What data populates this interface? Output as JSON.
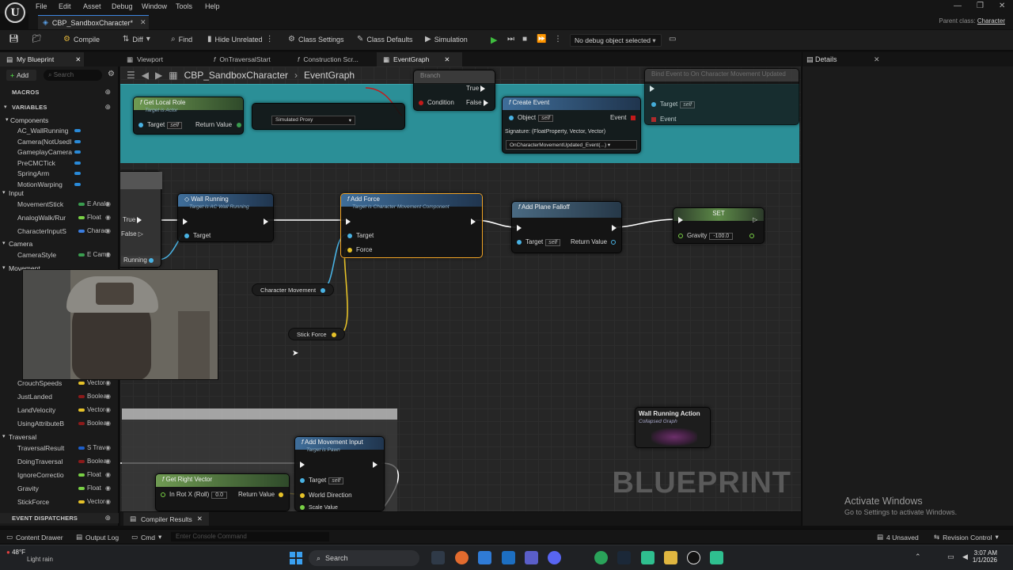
{
  "menu": {
    "items": [
      "File",
      "Edit",
      "Asset",
      "Debug",
      "Window",
      "Tools",
      "Help"
    ]
  },
  "asset_tab": {
    "title": "CBP_SandboxCharacter*"
  },
  "parent_class": {
    "label": "Parent class:",
    "value": "Character"
  },
  "toolbar": {
    "compile": "Compile",
    "diff": "Diff",
    "find": "Find",
    "hide_unrelated": "Hide Unrelated",
    "class_settings": "Class Settings",
    "class_defaults": "Class Defaults",
    "simulation": "Simulation",
    "debug_object": "No debug object selected"
  },
  "editor_tabs": {
    "my_blueprint": "My Blueprint",
    "viewport": "Viewport",
    "on_traversal_start": "OnTraversalStart",
    "construction_script": "Construction Scr...",
    "event_graph": "EventGraph",
    "details": "Details"
  },
  "left_panel": {
    "add": "Add",
    "search_placeholder": "Search",
    "macros": "MACROS",
    "variables": "VARIABLES",
    "categories": {
      "components": "Components",
      "input": "Input",
      "camera": "Camera",
      "movement": "Movement",
      "traversal": "Traversal"
    },
    "components": [
      {
        "name": "AC_WallRunning"
      },
      {
        "name": "Camera(NotUsedI"
      },
      {
        "name": "GameplayCamera"
      },
      {
        "name": "PreCMCTick"
      },
      {
        "name": "SpringArm"
      },
      {
        "name": "MotionWarping"
      }
    ],
    "input_vars": [
      {
        "name": "MovementStick",
        "type": "E Analc",
        "color": "#3a9d4f"
      },
      {
        "name": "AnalogWalk/Rur",
        "type": "Float",
        "color": "#79d045"
      },
      {
        "name": "CharacterInputS",
        "type": "Charac",
        "color": "#3a7de0"
      }
    ],
    "camera_vars": [
      {
        "name": "CameraStyle",
        "type": "E Came",
        "color": "#3a9d4f"
      }
    ],
    "movement_vars": [
      {
        "name": "CrouchSpeeds",
        "type": "Vector",
        "color": "#e6c229"
      },
      {
        "name": "JustLanded",
        "type": "Boolea",
        "color": "#8b1a1a"
      },
      {
        "name": "LandVelocity",
        "type": "Vector",
        "color": "#e6c229"
      },
      {
        "name": "UsingAttributeB",
        "type": "Boolea",
        "color": "#8b1a1a"
      }
    ],
    "traversal_vars": [
      {
        "name": "TraversalResult",
        "type": "S Trav",
        "color": "#1d5ec9"
      },
      {
        "name": "DoingTraversal",
        "type": "Boolea",
        "color": "#8b1a1a"
      },
      {
        "name": "IgnoreCorrectio",
        "type": "Float",
        "color": "#79d045"
      },
      {
        "name": "Gravity",
        "type": "Float",
        "color": "#79d045"
      },
      {
        "name": "StickForce",
        "type": "Vector",
        "color": "#e6c229"
      }
    ],
    "event_dispatchers": "EVENT DISPATCHERS"
  },
  "graph": {
    "breadcrumb": {
      "asset": "CBP_SandboxCharacter",
      "graph": "EventGraph"
    },
    "nodes": {
      "get_local_role": {
        "title": "Get Local Role",
        "sub": "Target is Actor",
        "target": "Target",
        "self": "self",
        "ret": "Return Value"
      },
      "simulated_proxy": "Simulated Proxy",
      "branch": {
        "title": "Branch",
        "condition": "Condition",
        "true": "True",
        "false": "False"
      },
      "create_event": {
        "title": "Create Event",
        "object": "Object",
        "self": "self",
        "event": "Event",
        "signature": "Signature: (FloatProperty, Vector, Vector)",
        "func": "OnCharacterMovementUpdated_Event(...)"
      },
      "bind_event": {
        "title": "Bind Event to On Character Movement Updated",
        "target": "Target",
        "self": "self",
        "event": "Event"
      },
      "wall_running": {
        "title": "Wall Running",
        "sub": "Target is AC Wall Running",
        "target": "Target"
      },
      "partial_branch": {
        "true": "True",
        "false": "False",
        "running": "Running"
      },
      "add_force": {
        "title": "Add Force",
        "sub": "Target is Character Movement Component",
        "target": "Target",
        "force": "Force"
      },
      "add_plane_falloff": {
        "title": "Add Plane Falloff",
        "target": "Target",
        "self": "self",
        "ret": "Return Value"
      },
      "set_gravity": {
        "title": "SET",
        "gravity": "Gravity",
        "value": "-100.0"
      },
      "character_movement": "Character Movement",
      "stick_force": "Stick Force",
      "wall_running_action": {
        "title": "Wall Running Action",
        "sub": "Collapsed Graph"
      },
      "add_movement_input": {
        "title": "Add Movement Input",
        "sub": "Target is Pawn",
        "target": "Target",
        "self": "self",
        "world_direction": "World Direction",
        "scale_value": "Scale Value"
      },
      "get_right_vector": {
        "title": "Get Right Vector",
        "in_rot": "In Rot X (Roll)",
        "val": "0.0",
        "ret": "Return Value"
      }
    },
    "watermark": "BLUEPRINT"
  },
  "activate_windows": {
    "title": "Activate Windows",
    "sub": "Go to Settings to activate Windows."
  },
  "bottom": {
    "compiler_results": "Compiler Results",
    "content_drawer": "Content Drawer",
    "output_log": "Output Log",
    "cmd": "Cmd",
    "console_placeholder": "Enter Console Command",
    "unsaved": "4 Unsaved",
    "revision_control": "Revision Control"
  },
  "taskbar": {
    "temp": "48°F",
    "weather": "Light rain",
    "search": "Search",
    "time": "3:07 AM",
    "date": "1/1/2026"
  }
}
